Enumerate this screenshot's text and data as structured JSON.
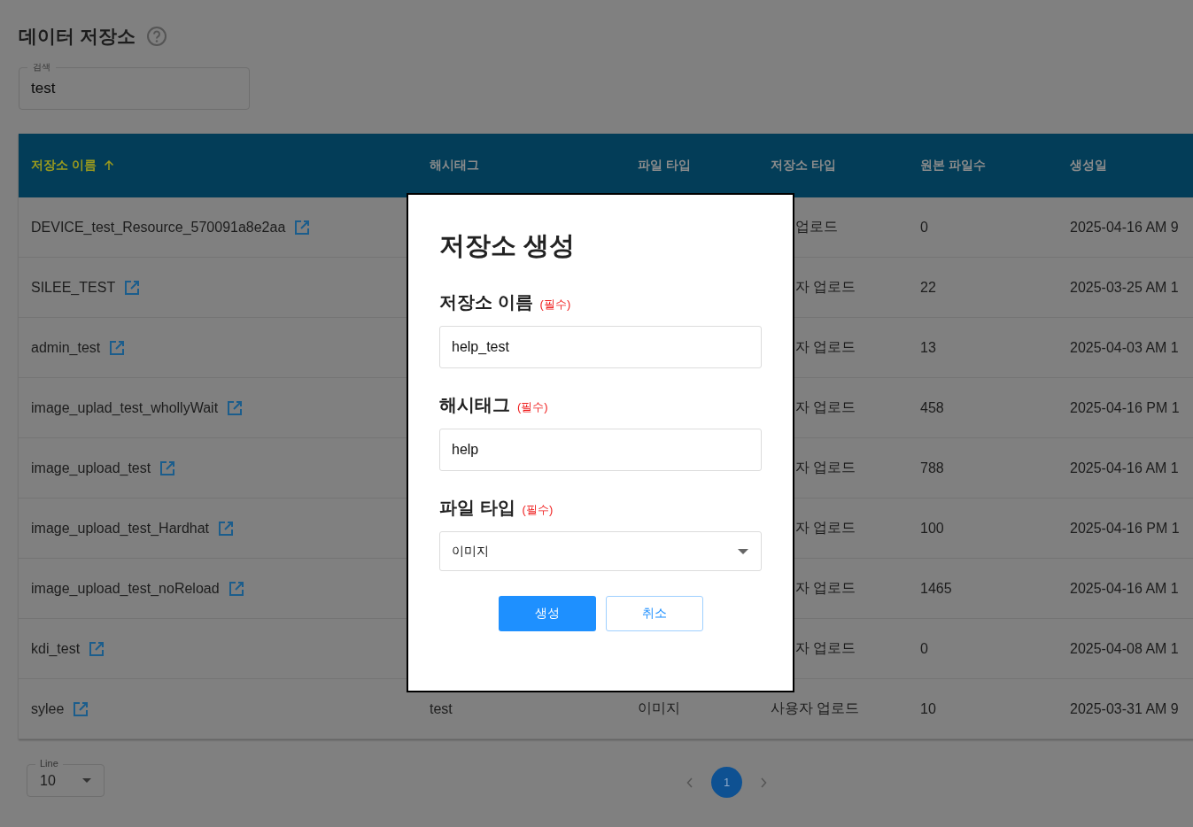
{
  "page": {
    "title": "데이터 저장소"
  },
  "search": {
    "label": "검색",
    "value": "test"
  },
  "table": {
    "columns": [
      {
        "label": "저장소 이름",
        "sorted": true
      },
      {
        "label": "해시태그",
        "sorted": false
      },
      {
        "label": "파일 타입",
        "sorted": false
      },
      {
        "label": "저장소 타입",
        "sorted": false
      },
      {
        "label": "원본 파일수",
        "sorted": false
      },
      {
        "label": "생성일",
        "sorted": false
      }
    ],
    "rows": [
      {
        "name": "DEVICE_test_Resource_570091a8e2aa",
        "storage_type": "업로드",
        "file_count": "0",
        "created": "2025-04-16 AM 9"
      },
      {
        "name": "SILEE_TEST",
        "storage_type": "자 업로드",
        "file_count": "22",
        "created": "2025-03-25 AM 1"
      },
      {
        "name": "admin_test",
        "storage_type": "자 업로드",
        "file_count": "13",
        "created": "2025-04-03 AM 1"
      },
      {
        "name": "image_uplad_test_whollyWait",
        "storage_type": "자 업로드",
        "file_count": "458",
        "created": "2025-04-16 PM 1"
      },
      {
        "name": "image_upload_test",
        "storage_type": "자 업로드",
        "file_count": "788",
        "created": "2025-04-16 AM 1"
      },
      {
        "name": "image_upload_test_Hardhat",
        "storage_type": "자 업로드",
        "file_count": "100",
        "created": "2025-04-16 PM 1"
      },
      {
        "name": "image_upload_test_noReload",
        "storage_type": "자 업로드",
        "file_count": "1465",
        "created": "2025-04-16 AM 1"
      },
      {
        "name": "kdi_test",
        "storage_type": "자 업로드",
        "file_count": "0",
        "created": "2025-04-08 AM 1"
      },
      {
        "name": "sylee",
        "hashtag": "test",
        "file_type": "이미지",
        "storage_type": "사용자 업로드",
        "file_count": "10",
        "created": "2025-03-31 AM 9"
      }
    ]
  },
  "pagination": {
    "line_label": "Line",
    "line_value": "10",
    "pages": [
      {
        "label": "1",
        "selected": true
      }
    ]
  },
  "modal": {
    "title": "저장소 생성",
    "fields": [
      {
        "kind": "text",
        "label": "저장소 이름",
        "required_text": "(필수)",
        "value": "help_test"
      },
      {
        "kind": "text",
        "label": "해시태그",
        "required_text": "(필수)",
        "value": "help"
      },
      {
        "kind": "select",
        "label": "파일 타입",
        "required_text": "(필수)",
        "value": "이미지"
      }
    ],
    "buttons": [
      {
        "kind": "primary",
        "label": "생성"
      },
      {
        "kind": "secondary",
        "label": "취소"
      }
    ]
  }
}
